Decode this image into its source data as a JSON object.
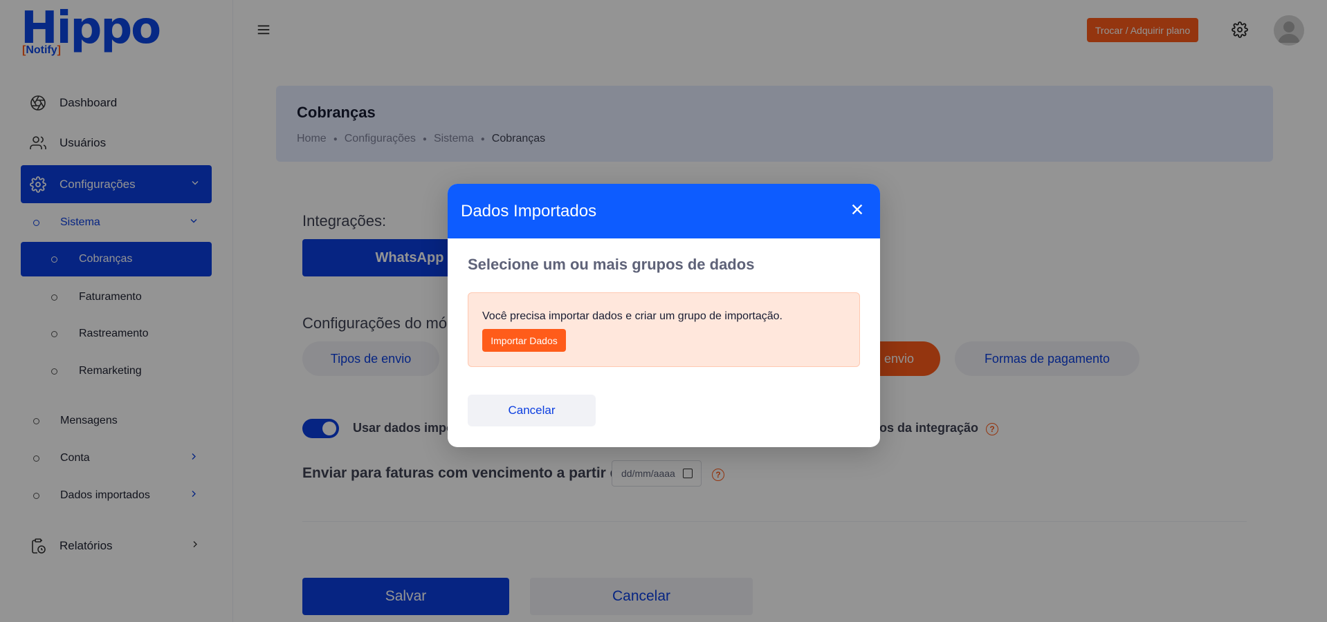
{
  "logo": {
    "main": "Hippo",
    "sub": "Notify"
  },
  "sidebar": {
    "dashboard": "Dashboard",
    "users": "Usuários",
    "settings": "Configurações",
    "system": "Sistema",
    "charges": "Cobranças",
    "billing": "Faturamento",
    "tracking": "Rastreamento",
    "remarketing": "Remarketing",
    "messages": "Mensagens",
    "account": "Conta",
    "imported_data": "Dados importados",
    "reports": "Relatórios"
  },
  "topbar": {
    "plan_button": "Trocar / Adquirir plano"
  },
  "page": {
    "title": "Cobranças",
    "breadcrumb": [
      "Home",
      "Configurações",
      "Sistema",
      "Cobranças"
    ]
  },
  "content": {
    "integrations_label": "Integrações:",
    "whatsapp": "WhatsApp",
    "config_label": "Configurações do mód",
    "tabs": {
      "send_types": "Tipos de envio",
      "send_visible": "envio",
      "payment_methods": "Formas de pagamento"
    },
    "toggle_label_left": "Usar dados impo",
    "toggle_label_right": "dos da integração",
    "date_label": "Enviar para faturas com vencimento a partir de:",
    "date_placeholder": "dd/mm/aaaa",
    "save": "Salvar",
    "cancel": "Cancelar"
  },
  "modal": {
    "title": "Dados Importados",
    "subtitle": "Selecione um ou mais grupos de dados",
    "alert_text": "Você precisa importar dados e criar um grupo de importação.",
    "import_button": "Importar Dados",
    "cancel_button": "Cancelar"
  },
  "colors": {
    "primary": "#0b3ee0",
    "modal_header": "#0d5cff",
    "accent": "#ff5c1a",
    "alert_bg": "#ffe7dc"
  }
}
